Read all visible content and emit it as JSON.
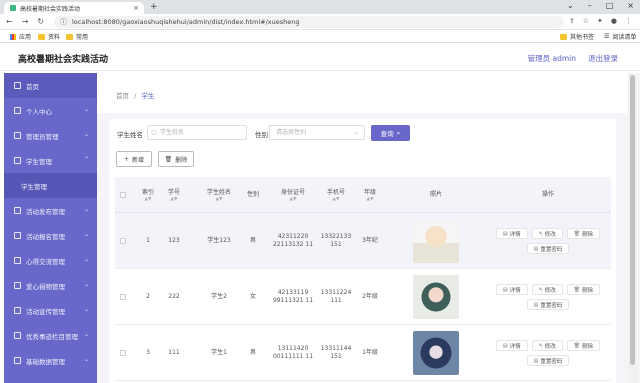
{
  "browser": {
    "tab_title": "高校暑期社会实践活动",
    "url": "localhost:8080/gaoxiaoshuqishehui/admin/dist/index.html#/xuesheng",
    "bookmarks": [
      "应用",
      "资料",
      "常用"
    ],
    "right_bookmarks": [
      "其他书签",
      "阅读清单"
    ],
    "icons": [
      "back-icon",
      "forward-icon",
      "reload-icon",
      "info-icon",
      "share-icon",
      "star-icon",
      "extensions-icon",
      "profile-icon",
      "menu-icon"
    ]
  },
  "header": {
    "title": "高校暑期社会实践活动",
    "user": "管理员 admin",
    "logout": "退出登录"
  },
  "sidebar": {
    "items": [
      {
        "label": "首页",
        "icon": "home-icon",
        "active": true
      },
      {
        "label": "个人中心",
        "icon": "user-icon",
        "chevron": "⌄"
      },
      {
        "label": "管理员管理",
        "icon": "list-icon",
        "chevron": "⌄"
      },
      {
        "label": "学生管理",
        "icon": "student-icon",
        "chevron": "⌃"
      },
      {
        "label": "学生管理",
        "sub": true
      },
      {
        "label": "活动发布管理",
        "icon": "list-icon",
        "chevron": "⌄"
      },
      {
        "label": "活动报名管理",
        "icon": "list-icon",
        "chevron": "⌄"
      },
      {
        "label": "心得交流管理",
        "icon": "list-icon",
        "chevron": "⌄"
      },
      {
        "label": "爱心捐物管理",
        "icon": "chart-icon",
        "chevron": "⌄"
      },
      {
        "label": "活动宣传管理",
        "icon": "list-icon",
        "chevron": "⌄"
      },
      {
        "label": "优秀事迹栏目管理",
        "icon": "list-icon",
        "chevron": "⌄"
      },
      {
        "label": "基础数据管理",
        "icon": "list-icon",
        "chevron": "⌄"
      }
    ]
  },
  "breadcrumb": {
    "home": "首页",
    "sep": "/",
    "current": "学生"
  },
  "search": {
    "name_label": "学生姓名",
    "name_placeholder": "学生姓名",
    "gender_label": "性别",
    "gender_placeholder": "请选择性别",
    "query": "查询"
  },
  "actions": {
    "add": "新增",
    "delete": "删除"
  },
  "table": {
    "headers": [
      "索引",
      "学号",
      "学生姓名",
      "性别",
      "身份证号",
      "手机号",
      "年级",
      "照片",
      "操作"
    ],
    "rows": [
      {
        "index": "1",
        "no": "123",
        "name": "学生123",
        "gender": "男",
        "id_card": "42311220 22113132 11",
        "phone": "13322133 151",
        "grade": "3年纪"
      },
      {
        "index": "2",
        "no": "222",
        "name": "学生2",
        "gender": "女",
        "id_card": "42133119 99111321 11",
        "phone": "13311224 111",
        "grade": "2年级"
      },
      {
        "index": "3",
        "no": "111",
        "name": "学生1",
        "gender": "男",
        "id_card": "13111420 00111111 11",
        "phone": "13311144 151",
        "grade": "1年级"
      }
    ],
    "ops": {
      "detail": "详情",
      "edit": "修改",
      "delete": "删除",
      "reset": "重置密码"
    }
  }
}
